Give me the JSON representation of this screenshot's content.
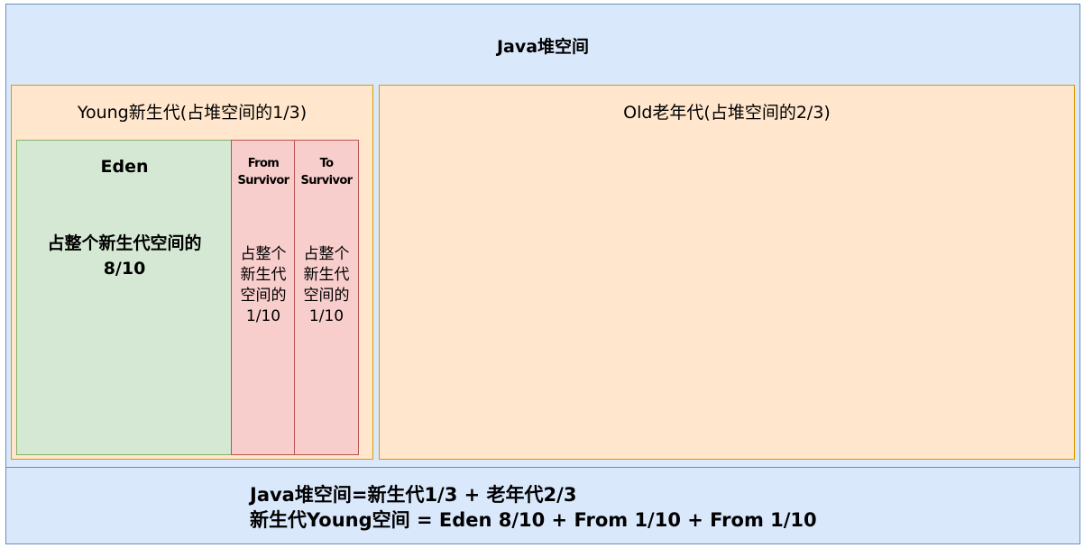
{
  "heap": {
    "title": "Java堆空间"
  },
  "young": {
    "title": "Young新生代(占堆空间的1/3)",
    "eden": {
      "title": "Eden",
      "desc_line1": "占整个新生代空间的",
      "desc_line2": "8/10"
    },
    "from_survivor": {
      "title": "From\nSurvivor",
      "desc": "占整个\n新生代\n空间的\n1/10"
    },
    "to_survivor": {
      "title": "To\nSurvivor",
      "desc": "占整个\n新生代\n空间的\n1/10"
    }
  },
  "old": {
    "title": "Old老年代(占堆空间的2/3)"
  },
  "summary": {
    "line1": "Java堆空间=新生代1/3 + 老年代2/3",
    "line2": "新生代Young空间 = Eden 8/10 + From 1/10 + From 1/10"
  },
  "colors": {
    "heap_fill": "#dae8fc",
    "heap_stroke": "#6c8ebf",
    "generation_fill": "#ffe6cc",
    "generation_stroke": "#d79b00",
    "eden_fill": "#d5e8d4",
    "eden_stroke": "#82b366",
    "survivor_fill": "#f8cecc",
    "survivor_stroke": "#b85450"
  }
}
